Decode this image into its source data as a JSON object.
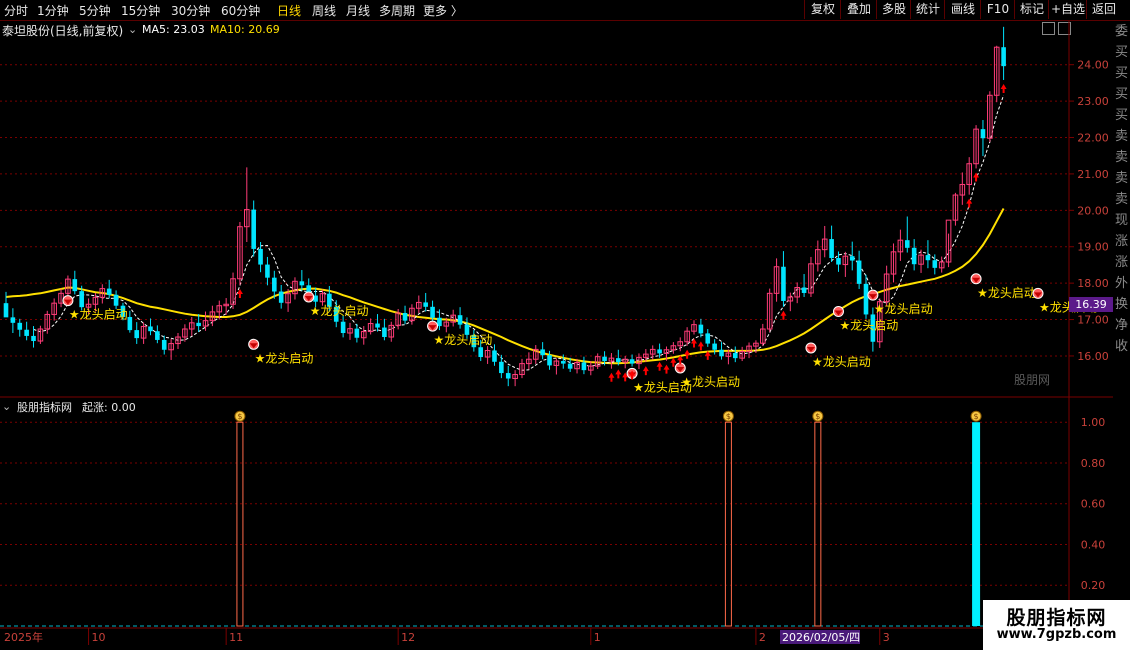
{
  "toolbar": {
    "periods": [
      "分时",
      "1分钟",
      "5分钟",
      "15分钟",
      "30分钟",
      "60分钟",
      "日线",
      "周线",
      "月线",
      "多周期",
      "更多"
    ],
    "active": "日线",
    "right_buttons": [
      "复权",
      "叠加",
      "多股",
      "统计",
      "画线",
      "F10",
      "标记",
      "+自选",
      "返回"
    ]
  },
  "info": {
    "stock": "泰坦股份(日线,前复权)",
    "ma5": "MA5: 23.03",
    "ma10": "MA10: 20.69"
  },
  "price_watermark": "股朋网",
  "current_price": "16.39",
  "indicator": {
    "title": "股朋指标网",
    "value": "起涨: 0.00"
  },
  "bottom_watermark": {
    "line1": "股朋指标网",
    "line2": "www.7gpzb.com"
  },
  "date_axis": {
    "year": "2025年",
    "months": [
      "10",
      "11",
      "12",
      "1",
      "2",
      "3"
    ],
    "cursor_date": "2026/02/05/四"
  },
  "right_strip": [
    "委",
    "买",
    "买",
    "买",
    "买",
    "卖",
    "卖",
    "卖",
    "卖",
    "现",
    "涨",
    "涨",
    "外",
    "换",
    "净",
    "收"
  ],
  "colors": {
    "up": "#ff3c78",
    "down": "#00e5ff",
    "ma5": "#ffffff",
    "ma10": "#ffe000",
    "grid": "#7a0000",
    "signal": "#ff0000",
    "label": "#ffe000"
  },
  "chart_data": [
    {
      "type": "candlestick",
      "ylim": [
        14.9,
        25.2
      ],
      "y_ticks": [
        "16.00",
        "17.00",
        "18.00",
        "19.00",
        "20.00",
        "21.00",
        "22.00",
        "23.00",
        "24.00"
      ],
      "candles_ohlc": [
        [
          17.45,
          17.76,
          17.28,
          17.06
        ],
        [
          17.06,
          17.31,
          16.63,
          16.91
        ],
        [
          16.91,
          17.02,
          16.53,
          16.72
        ],
        [
          16.72,
          16.94,
          16.43,
          16.55
        ],
        [
          16.55,
          16.82,
          16.23,
          16.41
        ],
        [
          16.41,
          16.83,
          16.33,
          16.74
        ],
        [
          16.74,
          17.24,
          16.61,
          17.14
        ],
        [
          17.14,
          17.58,
          16.97,
          17.45
        ],
        [
          17.45,
          17.85,
          17.34,
          17.72
        ],
        [
          17.72,
          18.21,
          17.59,
          18.11
        ],
        [
          18.11,
          18.34,
          17.69,
          17.78
        ],
        [
          17.78,
          17.93,
          17.25,
          17.34
        ],
        [
          17.34,
          17.58,
          17.15,
          17.42
        ],
        [
          17.42,
          17.73,
          17.22,
          17.61
        ],
        [
          17.61,
          17.97,
          17.44,
          17.85
        ],
        [
          17.85,
          18.09,
          17.58,
          17.68
        ],
        [
          17.68,
          17.8,
          17.29,
          17.38
        ],
        [
          17.38,
          17.46,
          16.98,
          17.07
        ],
        [
          17.07,
          17.24,
          16.64,
          16.71
        ],
        [
          16.71,
          16.93,
          16.33,
          16.49
        ],
        [
          16.49,
          16.92,
          16.33,
          16.81
        ],
        [
          16.81,
          17.03,
          16.57,
          16.68
        ],
        [
          16.68,
          16.84,
          16.35,
          16.44
        ],
        [
          16.44,
          16.56,
          16.04,
          16.17
        ],
        [
          16.17,
          16.47,
          15.89,
          16.34
        ],
        [
          16.34,
          16.63,
          16.19,
          16.52
        ],
        [
          16.52,
          16.87,
          16.39,
          16.74
        ],
        [
          16.74,
          17.07,
          16.55,
          16.91
        ],
        [
          16.91,
          17.15,
          16.66,
          16.82
        ],
        [
          16.82,
          17.22,
          16.69,
          16.97
        ],
        [
          16.97,
          17.38,
          16.82,
          17.21
        ],
        [
          17.21,
          17.52,
          17.0,
          17.38
        ],
        [
          17.38,
          17.59,
          17.13,
          17.42
        ],
        [
          17.42,
          18.29,
          17.29,
          18.12
        ],
        [
          18.12,
          19.68,
          17.95,
          19.55
        ],
        [
          19.55,
          21.18,
          19.13,
          20.02
        ],
        [
          20.02,
          20.27,
          18.73,
          18.94
        ],
        [
          18.94,
          19.13,
          18.3,
          18.51
        ],
        [
          18.51,
          18.72,
          17.94,
          18.15
        ],
        [
          18.15,
          18.34,
          17.57,
          17.77
        ],
        [
          17.77,
          17.95,
          17.3,
          17.46
        ],
        [
          17.46,
          17.84,
          17.21,
          17.71
        ],
        [
          17.71,
          18.16,
          17.55,
          18.05
        ],
        [
          18.05,
          18.36,
          17.79,
          17.94
        ],
        [
          17.94,
          18.13,
          17.5,
          17.66
        ],
        [
          17.66,
          17.88,
          17.34,
          17.49
        ],
        [
          17.49,
          17.82,
          17.38,
          17.71
        ],
        [
          17.71,
          17.92,
          17.24,
          17.35
        ],
        [
          17.35,
          17.53,
          16.79,
          16.94
        ],
        [
          16.94,
          17.12,
          16.51,
          16.63
        ],
        [
          16.63,
          16.91,
          16.44,
          16.75
        ],
        [
          16.75,
          16.88,
          16.37,
          16.5
        ],
        [
          16.5,
          16.82,
          16.31,
          16.67
        ],
        [
          16.67,
          17.03,
          16.59,
          16.89
        ],
        [
          16.89,
          17.15,
          16.67,
          16.78
        ],
        [
          16.78,
          17.02,
          16.43,
          16.52
        ],
        [
          16.52,
          16.94,
          16.39,
          16.84
        ],
        [
          16.84,
          17.29,
          16.73,
          17.18
        ],
        [
          17.18,
          17.38,
          16.87,
          16.97
        ],
        [
          16.97,
          17.42,
          16.86,
          17.31
        ],
        [
          17.31,
          17.66,
          17.18,
          17.47
        ],
        [
          17.47,
          17.73,
          17.22,
          17.35
        ],
        [
          17.35,
          17.52,
          16.97,
          17.05
        ],
        [
          17.05,
          17.28,
          16.71,
          16.82
        ],
        [
          16.82,
          17.05,
          16.65,
          16.93
        ],
        [
          16.93,
          17.27,
          16.81,
          17.12
        ],
        [
          17.12,
          17.34,
          16.75,
          16.86
        ],
        [
          16.86,
          17.06,
          16.47,
          16.58
        ],
        [
          16.58,
          16.71,
          16.12,
          16.24
        ],
        [
          16.24,
          16.44,
          15.86,
          15.97
        ],
        [
          15.97,
          16.27,
          15.78,
          16.15
        ],
        [
          16.15,
          16.32,
          15.73,
          15.84
        ],
        [
          15.84,
          16.03,
          15.39,
          15.53
        ],
        [
          15.53,
          15.73,
          15.17,
          15.38
        ],
        [
          15.38,
          15.61,
          15.17,
          15.49
        ],
        [
          15.49,
          15.92,
          15.39,
          15.79
        ],
        [
          15.79,
          16.1,
          15.63,
          15.91
        ],
        [
          15.91,
          16.3,
          15.78,
          16.18
        ],
        [
          16.18,
          16.38,
          15.91,
          16.02
        ],
        [
          16.02,
          16.14,
          15.62,
          15.74
        ],
        [
          15.74,
          15.93,
          15.49,
          15.86
        ],
        [
          15.86,
          16.04,
          15.65,
          15.79
        ],
        [
          15.79,
          15.95,
          15.56,
          15.65
        ],
        [
          15.65,
          15.92,
          15.52,
          15.82
        ],
        [
          15.82,
          15.98,
          15.5,
          15.61
        ],
        [
          15.61,
          15.86,
          15.47,
          15.72
        ],
        [
          15.72,
          16.07,
          15.64,
          15.98
        ],
        [
          15.98,
          16.13,
          15.74,
          15.86
        ],
        [
          15.86,
          16.08,
          15.65,
          15.94
        ],
        [
          15.94,
          16.17,
          15.74,
          15.83
        ],
        [
          15.83,
          16.0,
          15.66,
          15.91
        ],
        [
          15.91,
          16.04,
          15.71,
          15.79
        ],
        [
          15.79,
          16.07,
          15.64,
          15.96
        ],
        [
          15.96,
          16.19,
          15.83,
          16.05
        ],
        [
          16.05,
          16.29,
          15.9,
          16.18
        ],
        [
          16.18,
          16.34,
          15.95,
          16.07
        ],
        [
          16.07,
          16.26,
          15.87,
          16.17
        ],
        [
          16.17,
          16.38,
          16.06,
          16.28
        ],
        [
          16.28,
          16.51,
          16.13,
          16.39
        ],
        [
          16.39,
          16.79,
          16.28,
          16.68
        ],
        [
          16.68,
          16.98,
          16.59,
          16.86
        ],
        [
          16.86,
          17.02,
          16.51,
          16.62
        ],
        [
          16.62,
          16.74,
          16.25,
          16.34
        ],
        [
          16.34,
          16.46,
          16.04,
          16.17
        ],
        [
          16.17,
          16.38,
          15.9,
          15.99
        ],
        [
          15.99,
          16.18,
          15.77,
          16.08
        ],
        [
          16.08,
          16.26,
          15.83,
          15.94
        ],
        [
          15.94,
          16.25,
          15.86,
          16.12
        ],
        [
          16.12,
          16.37,
          15.94,
          16.27
        ],
        [
          16.27,
          16.43,
          16.08,
          16.35
        ],
        [
          16.35,
          16.88,
          16.28,
          16.74
        ],
        [
          16.74,
          17.85,
          16.66,
          17.72
        ],
        [
          17.72,
          18.68,
          17.49,
          18.45
        ],
        [
          18.45,
          18.88,
          17.35,
          17.51
        ],
        [
          17.51,
          17.74,
          17.23,
          17.62
        ],
        [
          17.62,
          18.02,
          17.45,
          17.88
        ],
        [
          17.88,
          18.25,
          17.62,
          17.73
        ],
        [
          17.73,
          18.72,
          17.62,
          18.53
        ],
        [
          18.53,
          19.17,
          18.32,
          18.92
        ],
        [
          18.92,
          19.57,
          18.71,
          19.21
        ],
        [
          19.21,
          19.58,
          18.58,
          18.69
        ],
        [
          18.69,
          18.87,
          18.31,
          18.51
        ],
        [
          18.51,
          18.86,
          18.17,
          18.74
        ],
        [
          18.74,
          19.14,
          18.35,
          18.62
        ],
        [
          18.62,
          18.89,
          17.84,
          17.98
        ],
        [
          17.98,
          18.23,
          17.02,
          17.14
        ],
        [
          17.14,
          17.33,
          16.12,
          16.39
        ],
        [
          16.39,
          17.58,
          16.22,
          17.49
        ],
        [
          17.49,
          18.48,
          17.36,
          18.25
        ],
        [
          18.25,
          19.09,
          18.02,
          18.86
        ],
        [
          18.86,
          19.47,
          18.61,
          19.18
        ],
        [
          19.18,
          19.83,
          18.84,
          18.97
        ],
        [
          18.97,
          19.21,
          18.35,
          18.52
        ],
        [
          18.52,
          18.92,
          18.28,
          18.77
        ],
        [
          18.77,
          19.18,
          18.41,
          18.63
        ],
        [
          18.63,
          18.79,
          18.24,
          18.42
        ],
        [
          18.42,
          18.73,
          18.29,
          18.58
        ],
        [
          18.58,
          19.36,
          18.44,
          19.73
        ],
        [
          19.73,
          20.48,
          19.58,
          20.42
        ],
        [
          20.42,
          21.04,
          20.15,
          20.71
        ],
        [
          20.71,
          21.46,
          20.43,
          21.28
        ],
        [
          21.28,
          22.34,
          21.15,
          22.23
        ],
        [
          22.23,
          22.48,
          21.49,
          21.98
        ],
        [
          21.98,
          23.27,
          21.88,
          23.16
        ],
        [
          23.16,
          24.52,
          22.97,
          24.48
        ],
        [
          24.48,
          25.04,
          23.58,
          23.96
        ]
      ],
      "ma10": [
        17.62,
        17.64,
        17.65,
        17.67,
        17.7,
        17.72,
        17.76,
        17.8,
        17.84,
        17.88,
        17.87,
        17.83,
        17.79,
        17.75,
        17.73,
        17.7,
        17.65,
        17.59,
        17.52,
        17.45,
        17.4,
        17.35,
        17.32,
        17.28,
        17.24,
        17.2,
        17.16,
        17.13,
        17.11,
        17.09,
        17.08,
        17.07,
        17.07,
        17.09,
        17.13,
        17.21,
        17.32,
        17.44,
        17.55,
        17.64,
        17.71,
        17.76,
        17.8,
        17.83,
        17.85,
        17.85,
        17.82,
        17.79,
        17.74,
        17.67,
        17.61,
        17.54,
        17.47,
        17.41,
        17.35,
        17.29,
        17.23,
        17.18,
        17.13,
        17.1,
        17.07,
        17.05,
        17.03,
        17.01,
        17.0,
        16.98,
        16.95,
        16.9,
        16.84,
        16.76,
        16.68,
        16.6,
        16.52,
        16.43,
        16.35,
        16.27,
        16.2,
        16.14,
        16.08,
        16.03,
        15.99,
        15.95,
        15.91,
        15.88,
        15.85,
        15.83,
        15.82,
        15.81,
        15.8,
        15.8,
        15.81,
        15.82,
        15.84,
        15.86,
        15.88,
        15.9,
        15.93,
        15.96,
        16.0,
        16.04,
        16.07,
        16.1,
        16.12,
        16.13,
        16.14,
        16.14,
        16.14,
        16.14,
        16.14,
        16.15,
        16.17,
        16.21,
        16.27,
        16.35,
        16.43,
        16.52,
        16.62,
        16.74,
        16.87,
        17.0,
        17.13,
        17.25,
        17.37,
        17.48,
        17.57,
        17.64,
        17.7,
        17.76,
        17.82,
        17.87,
        17.92,
        17.96,
        18.0,
        18.04,
        18.08,
        18.12,
        18.18,
        18.25,
        18.34,
        18.45,
        18.6,
        18.8,
        19.05,
        19.35,
        19.7,
        20.05
      ]
    },
    {
      "type": "bar",
      "name": "起涨",
      "ylim": [
        0,
        1.05
      ],
      "y_ticks": [
        "1.00",
        "0.80",
        "0.60",
        "0.40",
        "0.20"
      ],
      "signal_bars": [
        {
          "index": 34,
          "value": 1.0
        },
        {
          "index": 105,
          "value": 1.0
        },
        {
          "index": 118,
          "value": 1.0
        },
        {
          "index": 141,
          "value": 1.0
        }
      ]
    }
  ],
  "annotations": {
    "label_text": "★龙头启动",
    "dragon_labels": [
      {
        "index": 9,
        "price": 17.3
      },
      {
        "index": 36,
        "price": 16.1
      },
      {
        "index": 44,
        "price": 17.4
      },
      {
        "index": 62,
        "price": 16.6
      },
      {
        "index": 91,
        "price": 15.3
      },
      {
        "index": 98,
        "price": 15.45
      },
      {
        "index": 117,
        "price": 16.0
      },
      {
        "index": 121,
        "price": 17.0
      },
      {
        "index": 126,
        "price": 17.45
      },
      {
        "index": 141,
        "price": 17.9
      },
      {
        "index": 150,
        "price": 17.5
      }
    ]
  }
}
